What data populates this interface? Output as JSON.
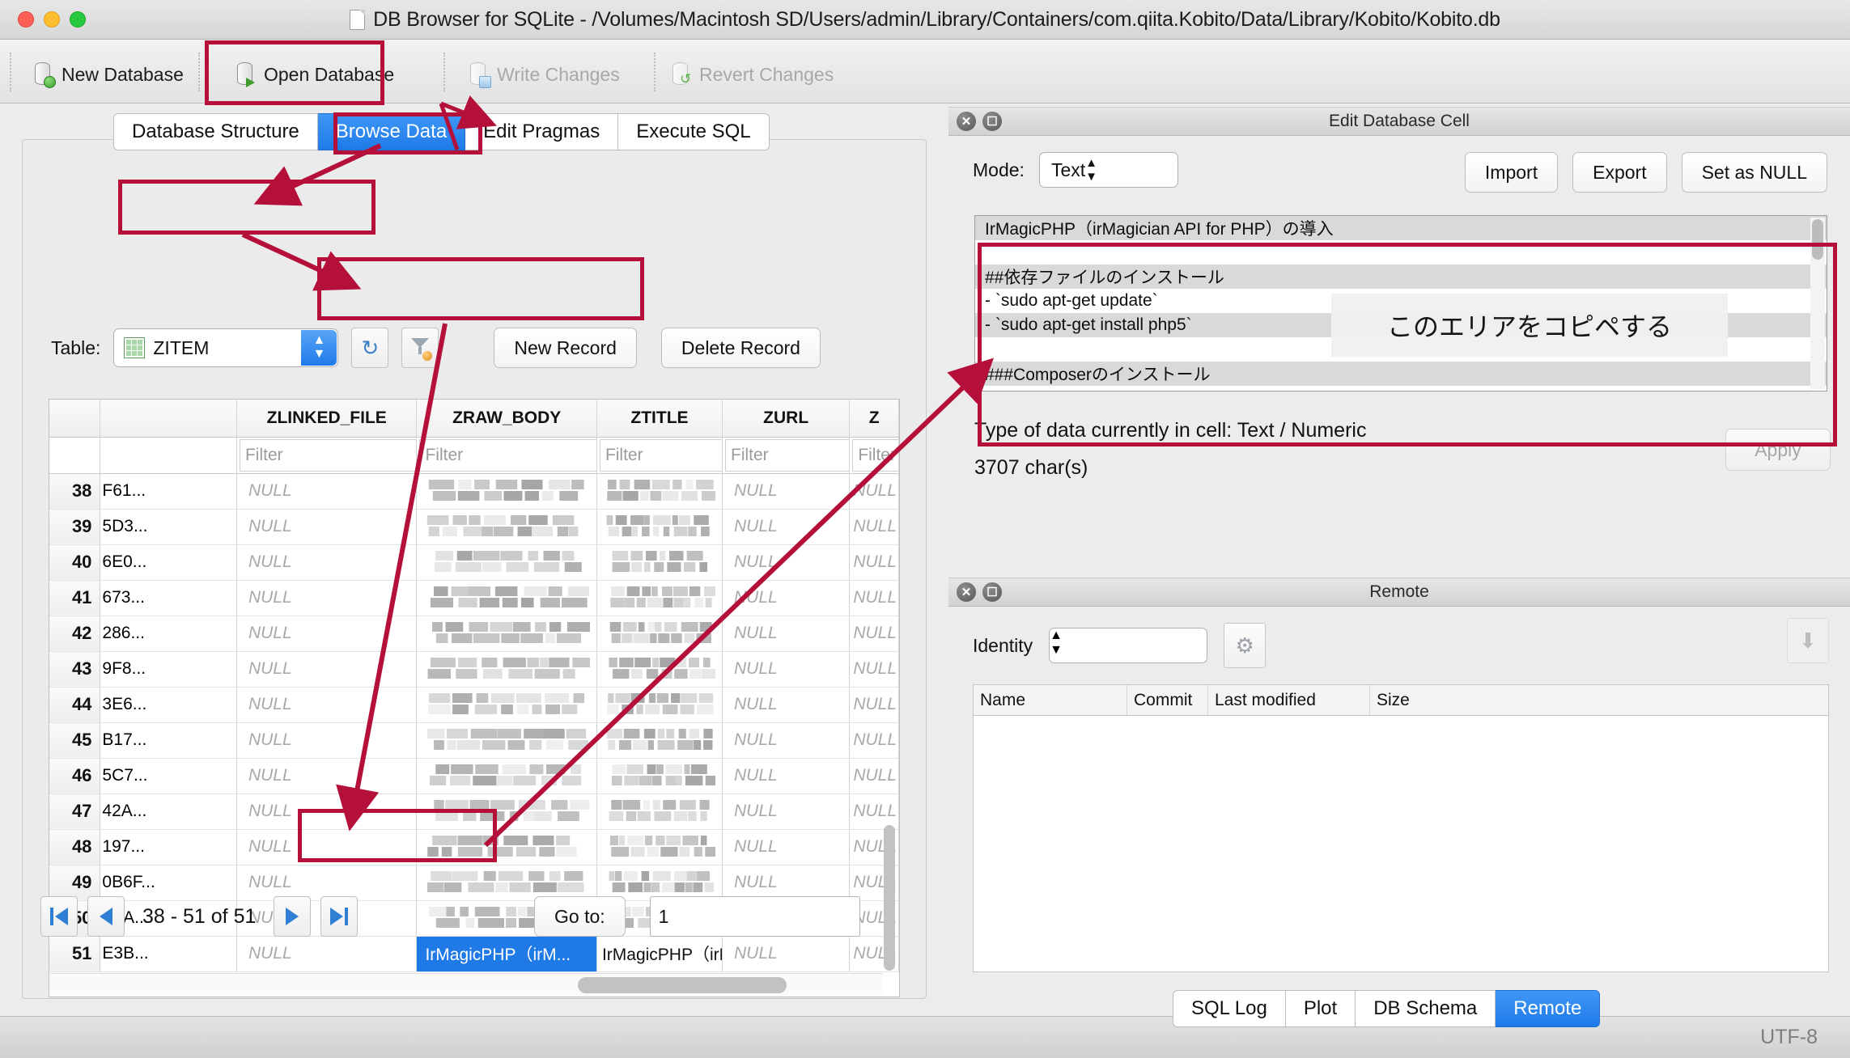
{
  "window": {
    "title": "DB Browser for SQLite - /Volumes/Macintosh SD/Users/admin/Library/Containers/com.qiita.Kobito/Data/Library/Kobito/Kobito.db"
  },
  "toolbar": {
    "items": [
      {
        "label": "New Database",
        "icon": "new-database-icon",
        "enabled": true
      },
      {
        "label": "Open Database",
        "icon": "open-database-icon",
        "enabled": true
      },
      {
        "label": "Write Changes",
        "icon": "write-changes-icon",
        "enabled": false
      },
      {
        "label": "Revert Changes",
        "icon": "revert-changes-icon",
        "enabled": false
      }
    ]
  },
  "main_tabs": [
    {
      "label": "Database Structure",
      "active": false
    },
    {
      "label": "Browse Data",
      "active": true
    },
    {
      "label": "Edit Pragmas",
      "active": false
    },
    {
      "label": "Execute SQL",
      "active": false
    }
  ],
  "browse": {
    "table_label": "Table:",
    "table_value": "ZITEM",
    "refresh_icon": "refresh-icon",
    "filter_icon": "clear-filter-icon",
    "new_record": "New Record",
    "delete_record": "Delete Record",
    "filter_placeholder": "Filter",
    "null_text": "NULL",
    "columns": [
      "ZLINKED_FILE",
      "ZRAW_BODY",
      "ZTITLE",
      "ZURL",
      "Z"
    ],
    "rows": [
      {
        "num": "38",
        "id": "F61...",
        "linked_file": "NULL",
        "raw_body": "mosaic",
        "title": "mosaic",
        "url": "NULL",
        "z": "NULL",
        "selected": false
      },
      {
        "num": "39",
        "id": "5D3...",
        "linked_file": "NULL",
        "raw_body": "mosaic",
        "title": "mosaic",
        "url": "NULL",
        "z": "NULL",
        "selected": false
      },
      {
        "num": "40",
        "id": "6E0...",
        "linked_file": "NULL",
        "raw_body": "mosaic",
        "title": "mosaic",
        "url": "NULL",
        "z": "NULL",
        "selected": false
      },
      {
        "num": "41",
        "id": "673...",
        "linked_file": "NULL",
        "raw_body": "mosaic",
        "title": "mosaic",
        "url": "NULL",
        "z": "NULL",
        "selected": false
      },
      {
        "num": "42",
        "id": "286...",
        "linked_file": "NULL",
        "raw_body": "mosaic",
        "title": "mosaic",
        "url": "NULL",
        "z": "NULL",
        "selected": false
      },
      {
        "num": "43",
        "id": "9F8...",
        "linked_file": "NULL",
        "raw_body": "mosaic",
        "title": "mosaic",
        "url": "NULL",
        "z": "NULL",
        "selected": false
      },
      {
        "num": "44",
        "id": "3E6...",
        "linked_file": "NULL",
        "raw_body": "mosaic",
        "title": "mosaic",
        "url": "NULL",
        "z": "NULL",
        "selected": false
      },
      {
        "num": "45",
        "id": "B17...",
        "linked_file": "NULL",
        "raw_body": "mosaic",
        "title": "mosaic",
        "url": "NULL",
        "z": "NULL",
        "selected": false
      },
      {
        "num": "46",
        "id": "5C7...",
        "linked_file": "NULL",
        "raw_body": "mosaic",
        "title": "mosaic",
        "url": "NULL",
        "z": "NULL",
        "selected": false
      },
      {
        "num": "47",
        "id": "42A...",
        "linked_file": "NULL",
        "raw_body": "mosaic",
        "title": "mosaic",
        "url": "NULL",
        "z": "NULL",
        "selected": false
      },
      {
        "num": "48",
        "id": "197...",
        "linked_file": "NULL",
        "raw_body": "mosaic",
        "title": "mosaic",
        "url": "NULL",
        "z": "NULL",
        "selected": false
      },
      {
        "num": "49",
        "id": "0B6F...",
        "linked_file": "NULL",
        "raw_body": "mosaic",
        "title": "mosaic",
        "url": "NULL",
        "z": "NULL",
        "selected": false
      },
      {
        "num": "50",
        "id": "0BA...",
        "linked_file": "NULL",
        "raw_body": "mosaic",
        "title": "mosaic",
        "url": "NULL",
        "z": "NULL",
        "selected": false
      },
      {
        "num": "51",
        "id": "E3B...",
        "linked_file": "NULL",
        "raw_body": "IrMagicPHP（irM...",
        "title": "IrMagicPHP（irM...",
        "url": "NULL",
        "z": "NULL",
        "selected": true
      }
    ],
    "pagination": {
      "range_text": "38 - 51 of 51",
      "first_icon": "first-page-icon",
      "prev_icon": "previous-page-icon",
      "next_icon": "next-page-icon",
      "last_icon": "last-page-icon",
      "goto_label": "Go to:",
      "goto_value": "1"
    }
  },
  "edit_cell_panel": {
    "title": "Edit Database Cell",
    "close_icon": "close-icon",
    "float_icon": "undock-icon",
    "mode_label": "Mode:",
    "mode_value": "Text",
    "import_label": "Import",
    "export_label": "Export",
    "set_null_label": "Set as NULL",
    "content_lines": [
      "IrMagicPHP（irMagician API for PHP）の導入",
      "",
      "##依存ファイルのインストール",
      "- `sudo apt-get update`",
      "- `sudo apt-get install php5`",
      "",
      "###Composerのインストール"
    ],
    "overlay_note": "このエリアをコピペする",
    "type_text": "Type of data currently in cell: Text / Numeric",
    "char_count_text": "3707 char(s)",
    "apply_label": "Apply"
  },
  "remote_panel": {
    "title": "Remote",
    "close_icon": "close-icon",
    "float_icon": "undock-icon",
    "identity_label": "Identity",
    "identity_value": "",
    "gear_icon": "settings-gear-icon",
    "push_icon": "push-icon",
    "columns": [
      "Name",
      "Commit",
      "Last modified",
      "Size"
    ],
    "rows": []
  },
  "bottom_tabs": [
    {
      "label": "SQL Log",
      "active": false
    },
    {
      "label": "Plot",
      "active": false
    },
    {
      "label": "DB Schema",
      "active": false
    },
    {
      "label": "Remote",
      "active": true
    }
  ],
  "statusbar": {
    "encoding": "UTF-8"
  },
  "annotation": {
    "color": "#b4103a"
  }
}
